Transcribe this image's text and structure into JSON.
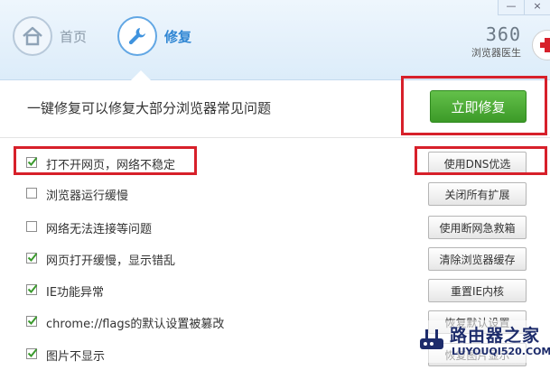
{
  "window": {
    "minimize": "—",
    "close": "×"
  },
  "tabs": [
    {
      "label": "首页",
      "icon": "home-icon"
    },
    {
      "label": "修复",
      "icon": "wrench-icon"
    }
  ],
  "brand": {
    "name": "360",
    "subtitle": "浏览器医生",
    "logo": "red-cross-icon"
  },
  "headline": "一键修复可以修复大部分浏览器常见问题",
  "fix_button": "立即修复",
  "accent_colors": {
    "primary": "#3c9a28",
    "tab_active": "#2f86d3",
    "highlight": "#d7202a"
  },
  "items": [
    {
      "label": "打不开网页，网络不稳定",
      "checked": true,
      "action": "使用DNS优选"
    },
    {
      "label": "浏览器运行缓慢",
      "checked": false,
      "action": "关闭所有扩展"
    },
    {
      "label": "网络无法连接等问题",
      "checked": false,
      "action": "使用断网急救箱"
    },
    {
      "label": "网页打开缓慢，显示错乱",
      "checked": true,
      "action": "清除浏览器缓存"
    },
    {
      "label": "IE功能异常",
      "checked": true,
      "action": "重置IE内核"
    },
    {
      "label": "chrome://flags的默认设置被篡改",
      "checked": true,
      "action": "恢复默认设置"
    },
    {
      "label": "图片不显示",
      "checked": true,
      "action": "恢复图片显示"
    }
  ],
  "watermark": {
    "title": "路由器之家",
    "url": "LUYOUQI520.COM"
  }
}
